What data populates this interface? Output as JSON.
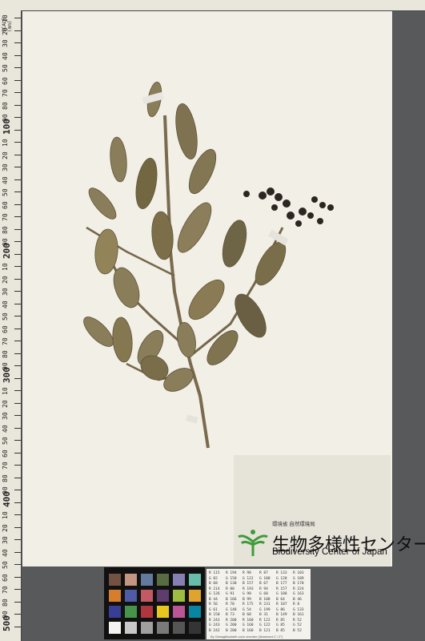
{
  "scale_label": "SCALE (mm)",
  "ruler_numbers": [
    "10",
    "20",
    "30",
    "40",
    "50",
    "60",
    "70",
    "80",
    "90",
    "100",
    "10",
    "20",
    "30",
    "40",
    "50",
    "60",
    "70",
    "80",
    "90",
    "200",
    "10",
    "20",
    "30",
    "40",
    "50",
    "60",
    "70",
    "80",
    "90",
    "300",
    "10",
    "20",
    "30",
    "40",
    "50",
    "60",
    "70",
    "80",
    "90",
    "400",
    "10",
    "20",
    "30",
    "40",
    "50",
    "60",
    "70",
    "80",
    "90",
    "500"
  ],
  "institution": {
    "ministry": "環境省 自然環境局",
    "name_ja": "生物多様性センター",
    "name_en": "Biodiversity Center of Japan"
  },
  "color_table": {
    "rows": [
      [
        "R 115",
        "R 194",
        "R 98",
        "R 87",
        "R 133",
        "R 103"
      ],
      [
        "G 82",
        "G 150",
        "G 122",
        "G 108",
        "G 128",
        "G 189"
      ],
      [
        "B 68",
        "B 130",
        "B 157",
        "B 67",
        "B 177",
        "B 170"
      ],
      [
        "R 214",
        "R 80",
        "R 193",
        "R 94",
        "R 157",
        "R 224"
      ],
      [
        "G 126",
        "G 91",
        "G 90",
        "G 60",
        "G 188",
        "G 163"
      ],
      [
        "B 44",
        "B 166",
        "B 99",
        "B 108",
        "B 64",
        "B 46"
      ],
      [
        "R 56",
        "R 70",
        "R 175",
        "R 231",
        "R 187",
        "R 8"
      ],
      [
        "G 61",
        "G 148",
        "G 54",
        "G 199",
        "G 86",
        "G 133"
      ],
      [
        "B 150",
        "B 73",
        "B 60",
        "B 31",
        "B 149",
        "B 161"
      ],
      [
        "R 243",
        "R 200",
        "R 160",
        "R 122",
        "R 85",
        "R 52"
      ],
      [
        "G 243",
        "G 200",
        "G 160",
        "G 122",
        "G 85",
        "G 52"
      ],
      [
        "B 242",
        "B 200",
        "B 160",
        "B 121",
        "B 85",
        "B 52"
      ]
    ],
    "footnote": "By GretagMacbeth color checker  (Illuminant C / 2°)"
  },
  "colors": {
    "checker": [
      "#735244",
      "#c29682",
      "#627a9d",
      "#576c43",
      "#8580b1",
      "#67bdaa",
      "#d67e2c",
      "#505ba6",
      "#c15a63",
      "#5e3c6c",
      "#9dbc40",
      "#e0a32e",
      "#383d96",
      "#469449",
      "#af363c",
      "#e7c71f",
      "#bb5695",
      "#0885a1",
      "#f3f3f2",
      "#c8c8c8",
      "#a0a0a0",
      "#7a7a79",
      "#555555",
      "#343434"
    ]
  }
}
